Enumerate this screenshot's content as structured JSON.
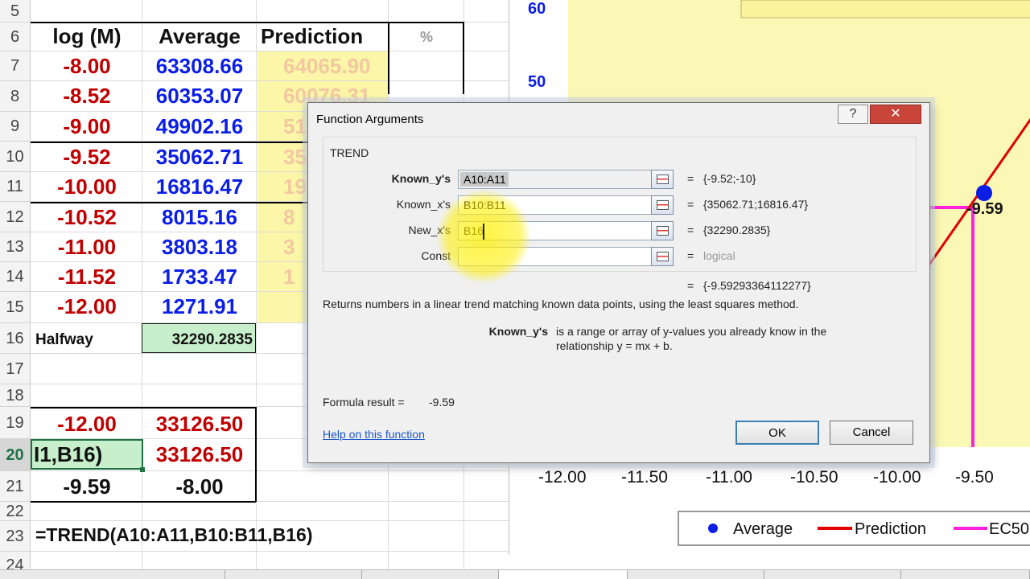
{
  "spreadsheet": {
    "row_numbers": [
      "5",
      "6",
      "7",
      "8",
      "9",
      "10",
      "11",
      "12",
      "13",
      "14",
      "15",
      "16",
      "17",
      "18",
      "19",
      "20",
      "21",
      "22",
      "23",
      "24"
    ],
    "headers": {
      "col_a": "log (M)",
      "col_b": "Average",
      "col_c": "Prediction",
      "col_d": "%"
    },
    "data_rows": [
      {
        "row": "7",
        "a": "-8.00",
        "b": "63308.66",
        "c": "64065.90"
      },
      {
        "row": "8",
        "a": "-8.52",
        "b": "60353.07",
        "c": "60076.31"
      },
      {
        "row": "9",
        "a": "-9.00",
        "b": "49902.16",
        "c": "51"
      },
      {
        "row": "10",
        "a": "-9.52",
        "b": "35062.71",
        "c": "35"
      },
      {
        "row": "11",
        "a": "-10.00",
        "b": "16816.47",
        "c": "19"
      },
      {
        "row": "12",
        "a": "-10.52",
        "b": "8015.16",
        "c": "8"
      },
      {
        "row": "13",
        "a": "-11.00",
        "b": "3803.18",
        "c": "3"
      },
      {
        "row": "14",
        "a": "-11.52",
        "b": "1733.47",
        "c": "1"
      },
      {
        "row": "15",
        "a": "-12.00",
        "b": "1271.91",
        "c": ""
      }
    ],
    "halfway": {
      "label": "Halfway",
      "value": "32290.2835"
    },
    "row19": {
      "a": "-12.00",
      "b": "33126.50"
    },
    "row20": {
      "a": "I1,B16)",
      "b": "33126.50"
    },
    "row21": {
      "a": "-9.59",
      "b": "-8.00"
    },
    "formula_text": "=TREND(A10:A11,B10:B11,B16)"
  },
  "chart": {
    "y_ticks": [
      "60",
      "50"
    ],
    "x_ticks": [
      "-12.00",
      "-11.50",
      "-11.00",
      "-10.50",
      "-10.00",
      "-9.50"
    ],
    "callout": "-9.59",
    "legend": [
      {
        "name": "Average",
        "color": "#0a1ee6",
        "marker": "dot"
      },
      {
        "name": "Prediction",
        "color": "#e00000",
        "marker": "line"
      },
      {
        "name": "EC50",
        "color": "#ff20e0",
        "marker": "line"
      }
    ]
  },
  "dialog": {
    "title": "Function Arguments",
    "help_glyph": "?",
    "close_glyph": "✕",
    "function_name": "TREND",
    "args": [
      {
        "label": "Known_y's",
        "value": "A10:A11",
        "result": "{-9.52;-10}",
        "bold": true
      },
      {
        "label": "Known_x's",
        "value": "B10:B11",
        "result": "{35062.71;16816.47}",
        "bold": false
      },
      {
        "label": "New_x's",
        "value": "B16",
        "result": "{32290.2835}",
        "bold": false
      },
      {
        "label": "Const",
        "value": "",
        "result": "logical",
        "bold": false
      }
    ],
    "equals": "=",
    "overall_result": "{-9.59293364112277}",
    "description": "Returns numbers in a linear trend matching known data points, using the least squares method.",
    "arg_help_name": "Known_y's",
    "arg_help_text_1": "is a range or array of y-values you already know in the",
    "arg_help_text_2": "relationship y = mx + b.",
    "formula_result_label": "Formula result =",
    "formula_result_value": "-9.59",
    "help_link": "Help on this function",
    "ok_label": "OK",
    "cancel_label": "Cancel"
  }
}
